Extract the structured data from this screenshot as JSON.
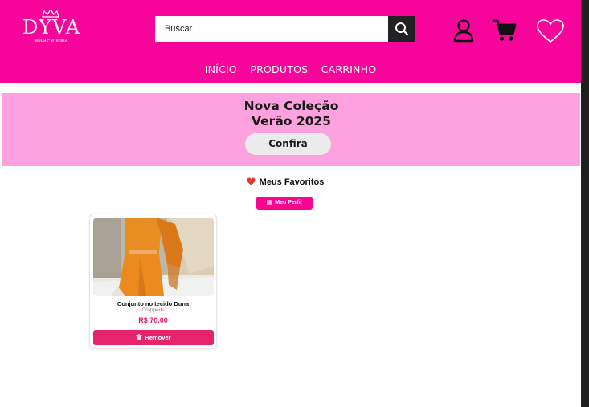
{
  "header": {
    "brand": "DYVA",
    "tagline": "Moda Feminina",
    "search_placeholder": "Buscar",
    "icons": [
      "user-icon",
      "cart-icon",
      "heart-icon",
      "search-icon"
    ],
    "background_color": "#f7059a"
  },
  "nav": {
    "items": [
      {
        "label": "INÍCIO"
      },
      {
        "label": "PRODUTOS"
      },
      {
        "label": "CARRINHO"
      }
    ]
  },
  "banner": {
    "title_line1": "Nova Coleção",
    "title_line2": "Verão 2025",
    "cta_label": "Confira",
    "background_color": "#fda2de"
  },
  "favorites": {
    "title": "Meus Favoritos",
    "profile_button_label": "Meu Perfil",
    "products": [
      {
        "name": "Conjunto no tecido Duna",
        "category": "Croppeds",
        "price": "R$ 70.00",
        "remove_label": "Remover"
      }
    ]
  },
  "colors": {
    "accent": "#f7059a",
    "price": "#e2186d",
    "remove_button": "#e6246c"
  }
}
